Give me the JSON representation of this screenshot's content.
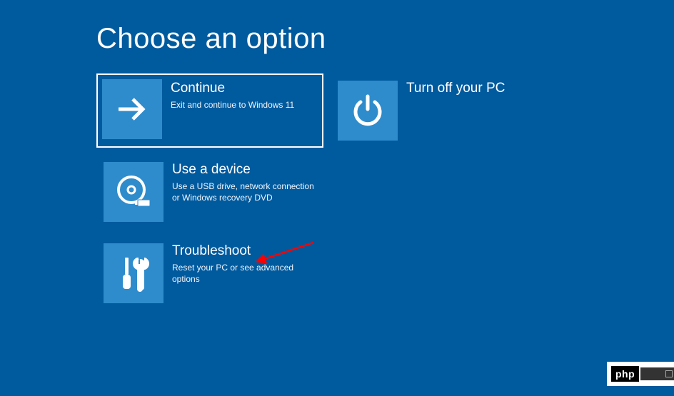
{
  "title": "Choose an option",
  "tiles": [
    {
      "id": "continue",
      "title": "Continue",
      "desc": "Exit and continue to Windows 11",
      "selected": true,
      "icon": "arrow-right"
    },
    {
      "id": "turn-off",
      "title": "Turn off your PC",
      "desc": "",
      "selected": false,
      "icon": "power"
    },
    {
      "id": "use-device",
      "title": "Use a device",
      "desc": "Use a USB drive, network connection or Windows recovery DVD",
      "selected": false,
      "icon": "disc-usb"
    },
    {
      "id": "troubleshoot",
      "title": "Troubleshoot",
      "desc": "Reset your PC or see advanced options",
      "selected": false,
      "icon": "tools"
    }
  ],
  "annotation": {
    "arrow_color": "#ff0000"
  },
  "watermark": {
    "text": "php"
  }
}
